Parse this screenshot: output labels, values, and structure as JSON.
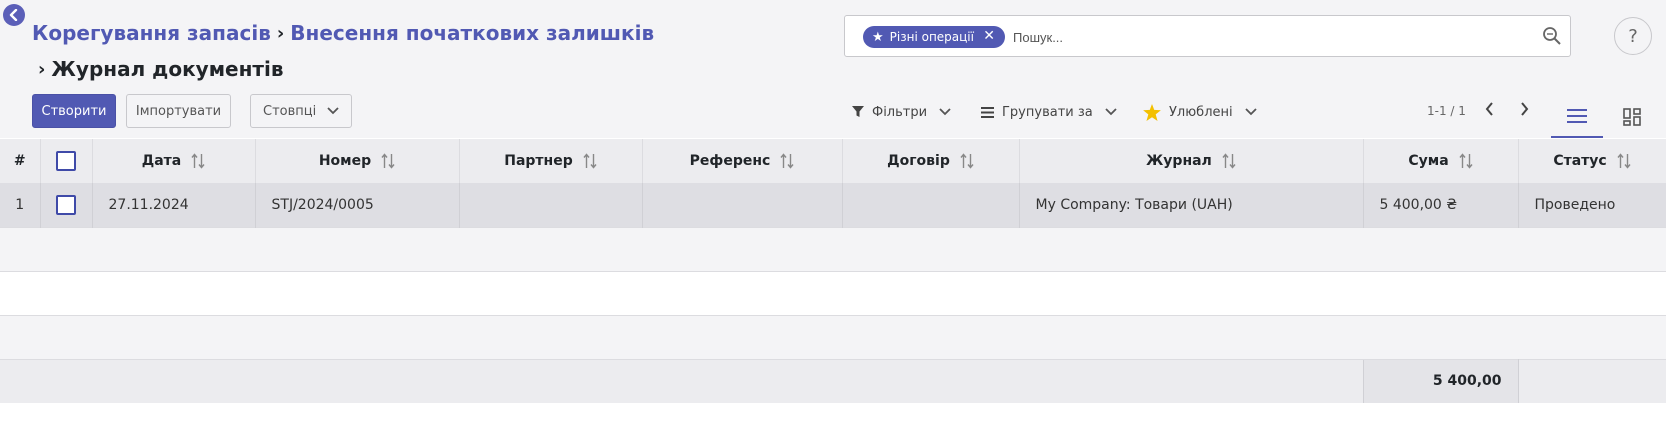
{
  "breadcrumb": {
    "item1": "Корегування запасів",
    "item2": "Внесення початкових залишків",
    "current": "Журнал документів"
  },
  "buttons": {
    "create": "Створити",
    "import": "Імпортувати",
    "columns": "Стовпці"
  },
  "search": {
    "facet": "Різні операції",
    "placeholder": "Пошук..."
  },
  "help_label": "?",
  "toolbar": {
    "filters": "Фільтри",
    "group_by": "Групувати за",
    "favorites": "Улюблені"
  },
  "pager": "1-1 / 1",
  "table": {
    "columns": [
      "#",
      "Дата",
      "Номер",
      "Партнер",
      "Референс",
      "Договір",
      "Журнал",
      "Сума",
      "Статус"
    ],
    "rows": [
      {
        "index": "1",
        "date": "27.11.2024",
        "number": "STJ/2024/0005",
        "partner": "",
        "reference": "",
        "contract": "",
        "journal": "My Company: Товари (UAH)",
        "amount": "5 400,00 ₴",
        "status": "Проведено"
      }
    ],
    "total": "5 400,00"
  },
  "colors": {
    "accent": "#5159b3",
    "favorite_star": "#f3c000"
  },
  "icons": [
    "back-arrow-icon",
    "close-icon",
    "search-icon",
    "filter-icon",
    "group-icon",
    "star-icon",
    "chevron-down-icon",
    "chevron-left-icon",
    "chevron-right-icon",
    "list-view-icon",
    "kanban-view-icon",
    "sort-icon"
  ]
}
